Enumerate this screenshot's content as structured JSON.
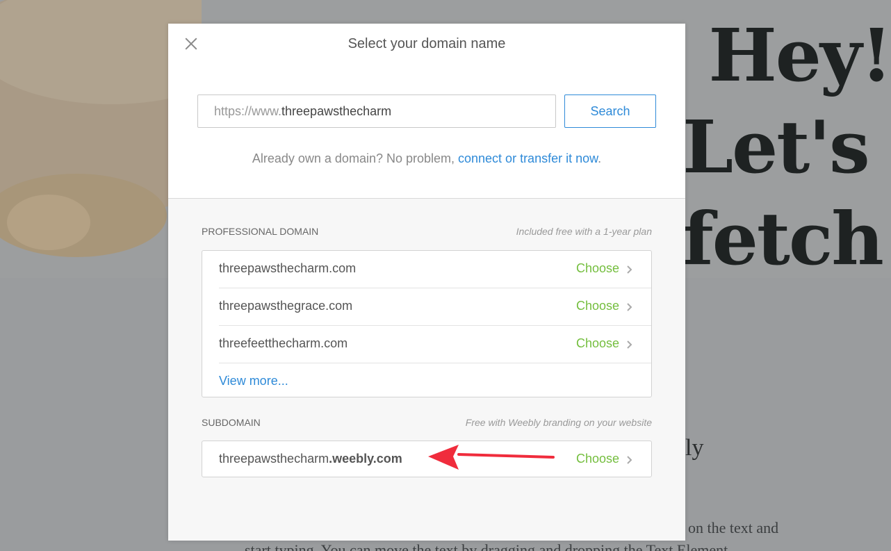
{
  "modal": {
    "title": "Select your domain name",
    "search": {
      "prefix": "https://www.",
      "value": "threepawsthecharm",
      "button_label": "Search"
    },
    "own_domain": {
      "text": "Already own a domain? No problem, ",
      "link": "connect or transfer it now",
      "end": "."
    },
    "professional": {
      "heading": "PROFESSIONAL DOMAIN",
      "note": "Included free with a 1-year plan",
      "items": [
        {
          "name": "threepawsthecharm.com",
          "action": "Choose"
        },
        {
          "name": "threepawsthegrace.com",
          "action": "Choose"
        },
        {
          "name": "threefeetthecharm.com",
          "action": "Choose"
        }
      ],
      "view_more": "View more..."
    },
    "subdomain": {
      "heading": "SUBDOMAIN",
      "note": "Free with Weebly branding on your website",
      "name_prefix": "threepawsthecharm",
      "name_suffix": ".weebly.com",
      "action": "Choose"
    }
  },
  "background": {
    "hero_lines": [
      "Hey!",
      "Let's play",
      "fetch!"
    ],
    "subtitle": "ly",
    "body_line1": "on the text and",
    "body_line2": "start typing. You can move the text by dragging and dropping the Text Element"
  },
  "colors": {
    "accent_blue": "#2e8ad8",
    "choose_green": "#74be3e",
    "arrow_red": "#f02c3c"
  }
}
